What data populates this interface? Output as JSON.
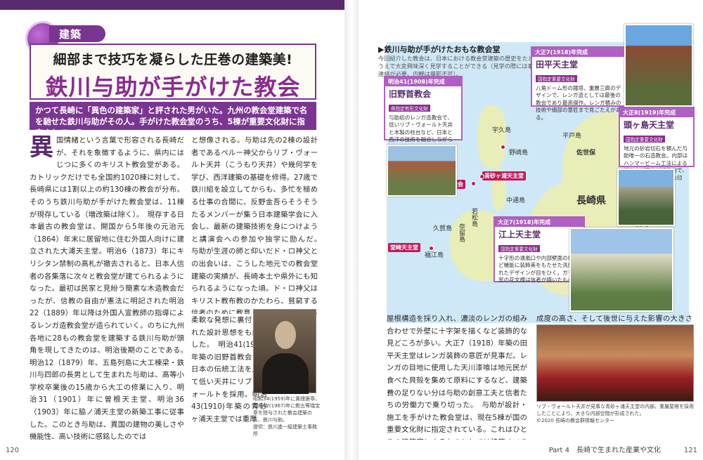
{
  "category": "建築",
  "title_sub": "細部まで技巧を凝らした圧巻の建築美!",
  "title_main": "鉄川与助が手がけた教会堂",
  "title_suffix": "建築",
  "lead": "かつて長崎に「異色の建築家」と評された男がいた。九州の教会堂建築で名を馳せた鉄川与助がその人。手がけた教会堂のうち、5棟が重要文化財に指定されている。",
  "left": {
    "dropcap": "異",
    "col1": "国情緒という言葉で形容される長崎だが、それを象徴するように、県内にはじつに多くのキリスト教会堂がある。カトリックだけでも全国約1020棟に対して、長崎県には1割以上の約130棟の教会が分布。そのうち鉄川与助が手がけた教会堂は、11棟が現存している（増改築は除く）。　現存する日本最古の教会堂は、開国から5年後の元治元（1864）年末に居留地に住む外国人向けに建立された大浦天主堂。明治6（1873）年にキリシタン禁制の高札が撤去されると、日本人信者の各集落に次々と教会堂が建てられるようになった。最初は民家と見紛う簡素な木造教会だったが、信教の自由が憲法に明記された明治22（1889）年以降は外国人宣教師の指導によるレンガ造教会堂が造られていく。のちに九州各地に28もの教会堂を建築する鉄川与助が頭角を現してきたのは、明治後期のことである。　明治12（1879）年、五島列島に大工棟梁・鉄川与四郎の長男として生まれた与助は、高等小学校卒業後の15歳から大工の修業に入り、明治31（1901）年に曽根天主堂、明治36（1903）年に脇ノ浦天主堂の新築工事に従事した。このとき与助は、異国の建物の美しさや機能性、高い技術に感銘したのでは",
    "col2": "と想像される。与助は先の2棟の設計者であるペルー神父からリブ・ヴォールト天井（こうもり天井）や幾何学を学び、西洋建築の基礎を修得。27歳で鉄川組を設立してからも、多忙を極める仕事の合間に、反野金吾らそうそうたるメンバーが集う日本建築学会に入会し、最新の建築技術を身につけようと講演会への参加や独学に励んだ。　与助が生涯の師と仰いだド・ロ神父との出会いは、こうした地元での教会堂建築の実績が、長崎本土や県外にも知られるようになった頃。ド・ロ神父はキリスト教布教のかたわら、貧窮する信者のために教育、医療、産業など私財を投じて支援した徳の高い慈父だった。与助は神父のもとでさまざまな工法や材の特徴などを学ぶとともに、",
    "col3": "柔軟な発想に裏付けられた設計思想をも継承した。　明治41(1908)年築の旧野首教会では日本の伝統工法を用いて低い天井にリブ・ヴォールトを採用。明治43(1910)年築の青砂ヶ浦天主堂では重厚",
    "portrait_caption": "昭和34(1959)年に黄綬褒章、昭和42(1967)年に勲五等瑞宝章を授与された教会建築の匠、鉄川与助。",
    "portrait_credit": "提供：鉄川進一級建築士事務所",
    "page_number": "120"
  },
  "right": {
    "map_title": "▶鉄川与助が手がけたおもな教会堂",
    "map_desc": "今回紹介した教会は、日本における教会堂建築の歴史をたどるうえで大変興味深く見学することができる（見学の際には事前連絡が必要。内観は撮影不可）。",
    "map_labels": [
      "宇久島",
      "中通島",
      "若松島",
      "奈留島",
      "久賀島",
      "福江島",
      "平戸島",
      "佐世保",
      "長崎県",
      "長崎",
      "野崎島"
    ],
    "church_tags": [
      "冷水教会",
      "青砂ヶ浦天主堂",
      "堂崎天主堂"
    ],
    "cards": [
      {
        "era": "明治41(1908)年完成",
        "name": "旧野首教会",
        "designation": "県指定有形文化財",
        "desc": "与助初のレンガ造教会で、低いリブ・ヴォールト天井と木製の柱台など、日本と西洋の技術を融合しながら試行錯誤した跡が見てとれる。"
      },
      {
        "era": "大正7(1918)年完成",
        "name": "田平天主堂",
        "designation": "国指定重要文化財",
        "desc": "八角ドーム形の鐘塔、重層三廊のデザインで、レンガ造としては最後の教会であり最高傑作。レンガ積みの技術や細部の意匠まで見ごたえがある。"
      },
      {
        "era": "大正8(1919)年完成",
        "name": "頭ヶ島天主堂",
        "designation": "国指定重要文化財",
        "desc": "地元の砂岩切石を積んだ与助唯一の石造教会。内部はハンマービーム工法による折り上げ天井が特徴的で、椿をあしらった可憐な印象。"
      },
      {
        "era": "大正7(1918)年完成",
        "name": "江上天主堂",
        "designation": "国指定重要文化財",
        "desc": "十字形の通風口や内部壁面の椿など機能に装飾美をもたせた洗練されたデザインが目をひく。ガラス窓の花文様は信者が描いたもの。"
      }
    ],
    "col1": "屋根構造を採り入れ、濃淡のレンガの組み合わせで外壁に十字架を描くなど装飾的な見どころが多い。大正7（1918）年築の田平天主堂はレンガ装飾の意匠が見事だ。レンガの目地に使用した天川漆喰は地元民が食べた貝殻を集めて原料にするなど、建築費の足りない分は与助の創意工夫と信者たちの労働力で乗り切った。　与助が設計・施工を手がけた教会堂は、現在5棟が国の重要文化財に指定されている。これはひとりの建築家によるものとしては特筆すべき数であり、与助による教会堂建築の完",
    "col2": "成度の高さ、そして後世に与えた影響の大きさを表しているといえるだろう。",
    "interior_caption": "リブ・ヴォールト天井が見事な青砂ヶ浦天主堂の内部。重層屋根を採用したことにより、大きな内部空間が形成された。",
    "interior_credit": "©2020 長崎の教会群情報センター",
    "footer": "Part 4　長崎で生まれた産業や文化",
    "page_number": "121"
  }
}
